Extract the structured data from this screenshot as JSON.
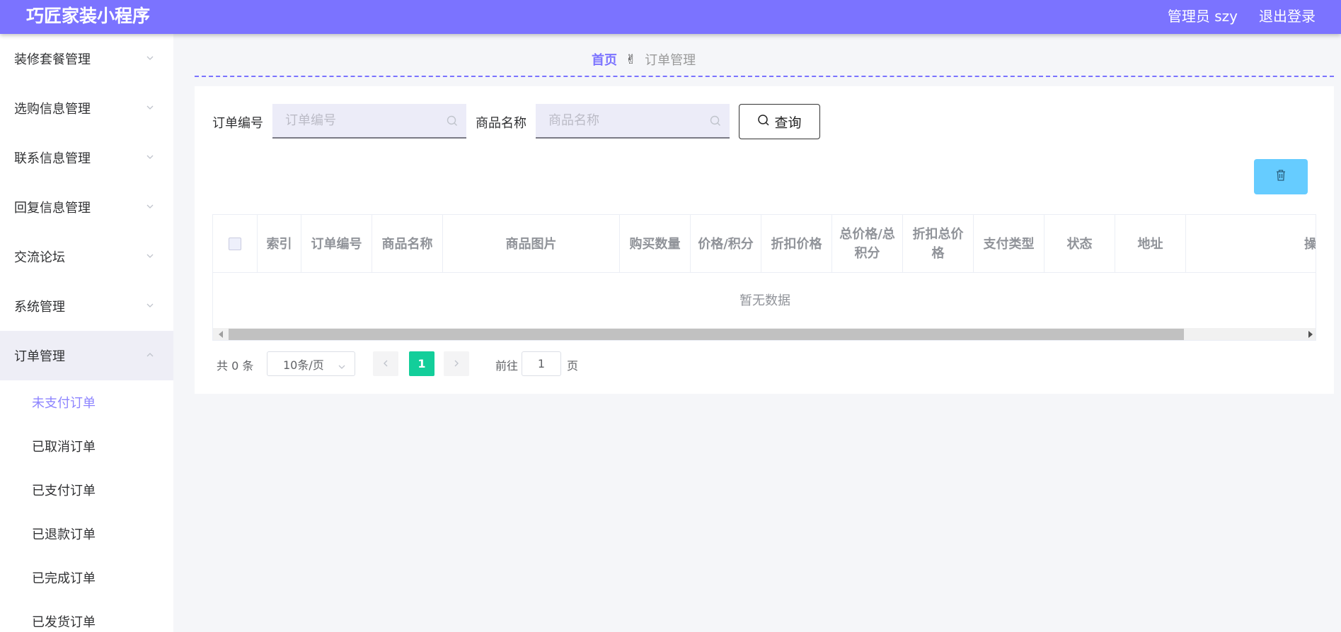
{
  "header": {
    "app_title": "巧匠家装小程序",
    "admin_label": "管理员 szy",
    "logout_label": "退出登录"
  },
  "sidebar": {
    "menus": [
      {
        "label": "装修套餐管理"
      },
      {
        "label": "选购信息管理"
      },
      {
        "label": "联系信息管理"
      },
      {
        "label": "回复信息管理"
      },
      {
        "label": "交流论坛"
      },
      {
        "label": "系统管理"
      },
      {
        "label": "订单管理"
      }
    ],
    "submenus": [
      {
        "label": "未支付订单"
      },
      {
        "label": "已取消订单"
      },
      {
        "label": "已支付订单"
      },
      {
        "label": "已退款订单"
      },
      {
        "label": "已完成订单"
      },
      {
        "label": "已发货订单"
      }
    ]
  },
  "breadcrumb": {
    "home": "首页",
    "hand": "✌",
    "current": "订单管理"
  },
  "search": {
    "order_no_label": "订单编号",
    "order_no_placeholder": "订单编号",
    "product_label": "商品名称",
    "product_placeholder": "商品名称",
    "query_label": "查询"
  },
  "table": {
    "columns": [
      "索引",
      "订单编号",
      "商品名称",
      "商品图片",
      "购买数量",
      "价格/积分",
      "折扣价格",
      "总价格/总积分",
      "折扣总价格",
      "支付类型",
      "状态",
      "地址",
      "操"
    ],
    "empty_text": "暂无数据"
  },
  "pagination": {
    "total": "共 0 条",
    "page_size": "10条/页",
    "current_page": "1",
    "goto_label": "前往",
    "goto_value": "1",
    "page_suffix": "页"
  },
  "colors": {
    "brand": "#7b73ff",
    "active_sub": "#8d84ff",
    "pager_active": "#13ce9a",
    "delete_button": "#66ccff"
  }
}
